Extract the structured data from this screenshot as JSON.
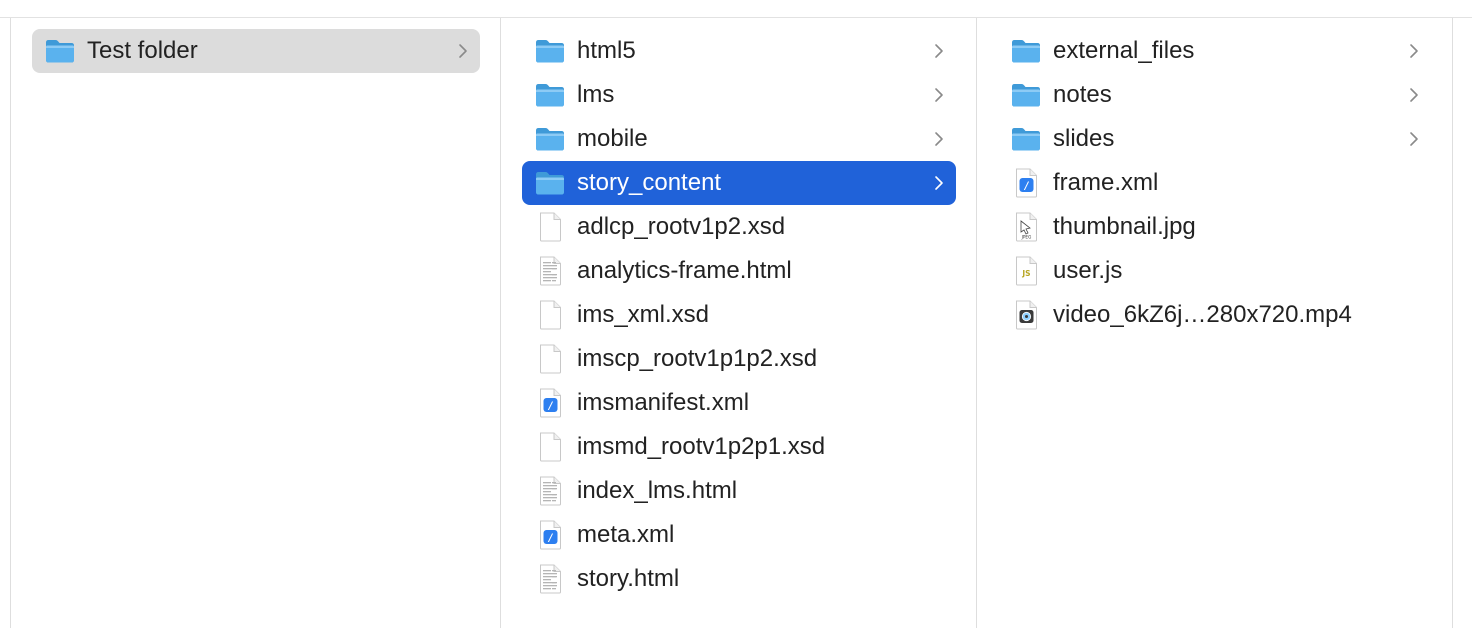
{
  "colors": {
    "selection_active": "#2062d9",
    "selection_inactive": "#dcdcdc",
    "folder_blue": "#5ab2ee",
    "divider": "#dedede"
  },
  "columns": [
    {
      "items": [
        {
          "label": "Test folder",
          "icon": "folder-icon",
          "has_children": true,
          "selected": "inactive"
        }
      ]
    },
    {
      "items": [
        {
          "label": "html5",
          "icon": "folder-icon",
          "has_children": true
        },
        {
          "label": "lms",
          "icon": "folder-icon",
          "has_children": true
        },
        {
          "label": "mobile",
          "icon": "folder-icon",
          "has_children": true
        },
        {
          "label": "story_content",
          "icon": "folder-icon",
          "has_children": true,
          "selected": "active"
        },
        {
          "label": "adlcp_rootv1p2.xsd",
          "icon": "blank-document-icon"
        },
        {
          "label": "analytics-frame.html",
          "icon": "html-document-icon"
        },
        {
          "label": "ims_xml.xsd",
          "icon": "blank-document-icon"
        },
        {
          "label": "imscp_rootv1p1p2.xsd",
          "icon": "blank-document-icon"
        },
        {
          "label": "imsmanifest.xml",
          "icon": "xml-document-icon"
        },
        {
          "label": "imsmd_rootv1p2p1.xsd",
          "icon": "blank-document-icon"
        },
        {
          "label": "index_lms.html",
          "icon": "html-document-icon"
        },
        {
          "label": "meta.xml",
          "icon": "xml-document-icon"
        },
        {
          "label": "story.html",
          "icon": "html-document-icon"
        }
      ]
    },
    {
      "items": [
        {
          "label": "external_files",
          "icon": "folder-icon",
          "has_children": true
        },
        {
          "label": "notes",
          "icon": "folder-icon",
          "has_children": true
        },
        {
          "label": "slides",
          "icon": "folder-icon",
          "has_children": true
        },
        {
          "label": "frame.xml",
          "icon": "xml-document-icon"
        },
        {
          "label": "thumbnail.jpg",
          "icon": "jpg-document-icon",
          "icon_text": "JPEG"
        },
        {
          "label": "user.js",
          "icon": "js-document-icon",
          "icon_text": "JS"
        },
        {
          "label": "video_6kZ6j…280x720.mp4",
          "icon": "video-document-icon"
        }
      ]
    }
  ]
}
